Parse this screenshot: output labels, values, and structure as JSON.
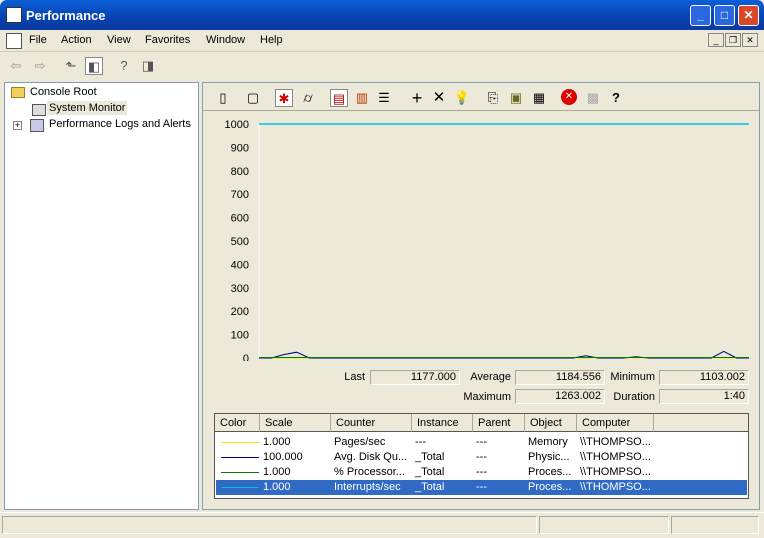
{
  "window": {
    "title": "Performance"
  },
  "menu": [
    "File",
    "Action",
    "View",
    "Favorites",
    "Window",
    "Help"
  ],
  "tree": {
    "root": "Console Root",
    "items": [
      "System Monitor",
      "Performance Logs and Alerts"
    ]
  },
  "sm_toolbar_icons": [
    "new-counter-set-icon",
    "clear-display-icon",
    "view-current-activity-icon",
    "view-log-data-icon",
    "view-graph-icon",
    "view-histogram-icon",
    "view-report-icon",
    "add-counter-icon",
    "delete-counter-icon",
    "highlight-icon",
    "copy-properties-icon",
    "paste-counter-list-icon",
    "properties-icon",
    "freeze-display-icon",
    "update-data-icon",
    "help-icon"
  ],
  "stats": {
    "last_label": "Last",
    "last": "1177.000",
    "average_label": "Average",
    "average": "1184.556",
    "minimum_label": "Minimum",
    "minimum": "1103.002",
    "maximum_label": "Maximum",
    "maximum": "1263.002",
    "duration_label": "Duration",
    "duration": "1:40"
  },
  "table": {
    "headers": [
      "Color",
      "Scale",
      "Counter",
      "Instance",
      "Parent",
      "Object",
      "Computer"
    ],
    "rows": [
      {
        "color": "#f0f000",
        "scale": "1.000",
        "counter": "Pages/sec",
        "instance": "---",
        "parent": "---",
        "object": "Memory",
        "computer": "\\\\THOMPSO..."
      },
      {
        "color": "#000080",
        "scale": "100.000",
        "counter": "Avg. Disk Qu...",
        "instance": "_Total",
        "parent": "---",
        "object": "Physic...",
        "computer": "\\\\THOMPSO..."
      },
      {
        "color": "#008000",
        "scale": "1.000",
        "counter": "% Processor...",
        "instance": "_Total",
        "parent": "---",
        "object": "Proces...",
        "computer": "\\\\THOMPSO..."
      },
      {
        "color": "#00c0e0",
        "scale": "1.000",
        "counter": "Interrupts/sec",
        "instance": "_Total",
        "parent": "---",
        "object": "Proces...",
        "computer": "\\\\THOMPSO...",
        "selected": true
      }
    ]
  },
  "chart_data": {
    "type": "line",
    "ylim": [
      0,
      1000
    ],
    "yticks": [
      "0",
      "100",
      "200",
      "300",
      "400",
      "500",
      "600",
      "700",
      "800",
      "900",
      "1000"
    ],
    "x": [
      0,
      1,
      2,
      3,
      4,
      5,
      6,
      7,
      8,
      9,
      10,
      11,
      12,
      13,
      14,
      15,
      16,
      17,
      18,
      19,
      20,
      21,
      22,
      23,
      24,
      25,
      26,
      27,
      28,
      29,
      30,
      31,
      32,
      33,
      34,
      35,
      36,
      37,
      38,
      39
    ],
    "series": [
      {
        "name": "Pages/sec",
        "color": "#f0f000",
        "values": [
          0,
          0,
          0,
          0,
          0,
          0,
          0,
          0,
          0,
          0,
          0,
          0,
          0,
          0,
          0,
          0,
          0,
          0,
          0,
          0,
          0,
          0,
          0,
          0,
          0,
          0,
          0,
          0,
          0,
          0,
          0,
          0,
          0,
          0,
          0,
          0,
          0,
          0,
          0,
          0
        ]
      },
      {
        "name": "Avg. Disk Queue Length",
        "color": "#000080",
        "values": [
          0,
          0,
          15,
          25,
          0,
          0,
          0,
          0,
          0,
          0,
          0,
          0,
          0,
          0,
          0,
          0,
          0,
          0,
          0,
          0,
          0,
          0,
          0,
          0,
          0,
          0,
          10,
          0,
          0,
          0,
          5,
          0,
          0,
          0,
          0,
          0,
          0,
          28,
          0,
          0
        ]
      },
      {
        "name": "% Processor Time",
        "color": "#008000",
        "values": [
          2,
          2,
          2,
          2,
          2,
          2,
          2,
          2,
          2,
          2,
          2,
          2,
          2,
          2,
          2,
          2,
          2,
          2,
          2,
          2,
          2,
          2,
          2,
          2,
          2,
          2,
          2,
          2,
          2,
          2,
          2,
          2,
          2,
          2,
          2,
          2,
          2,
          2,
          2,
          2
        ]
      },
      {
        "name": "Interrupts/sec",
        "color": "#00c0e0",
        "values": [
          1000,
          1000,
          1000,
          1000,
          1000,
          1000,
          1000,
          1000,
          1000,
          1000,
          1000,
          1000,
          1000,
          1000,
          1000,
          1000,
          1000,
          1000,
          1000,
          1000,
          1000,
          1000,
          1000,
          1000,
          1000,
          1000,
          1000,
          1000,
          1000,
          1000,
          1000,
          1000,
          1000,
          1000,
          1000,
          1000,
          1000,
          1000,
          1000,
          1000
        ]
      }
    ]
  }
}
